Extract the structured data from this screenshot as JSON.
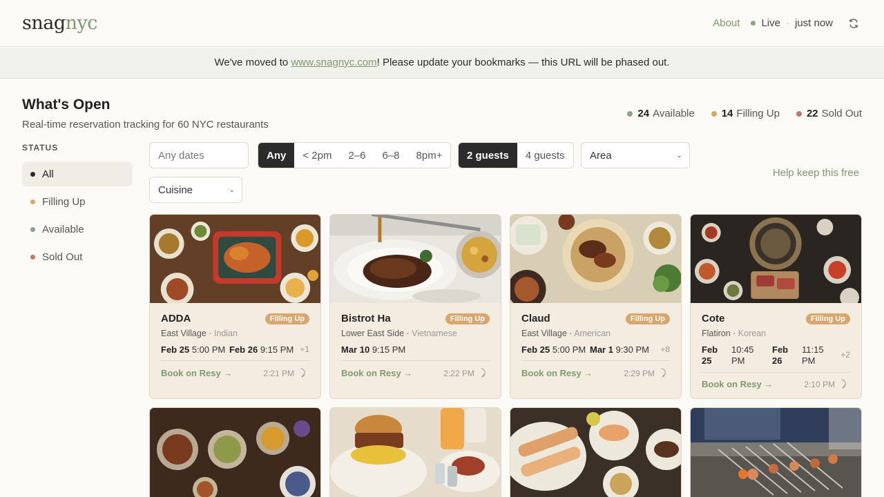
{
  "header": {
    "logo_main": "snag",
    "logo_accent": "nyc",
    "about": "About",
    "live": "Live",
    "separator": "·",
    "updated": "just now"
  },
  "banner": {
    "before": "We've moved to ",
    "link": "www.snagnyc.com",
    "after": "! Please update your bookmarks — this URL will be phased out."
  },
  "page": {
    "title": "What's Open",
    "subtitle": "Real-time reservation tracking for 60 NYC restaurants"
  },
  "summary": [
    {
      "count": "24",
      "label": "Available",
      "color": "#8ca384"
    },
    {
      "count": "14",
      "label": "Filling Up",
      "color": "#d9a66e"
    },
    {
      "count": "22",
      "label": "Sold Out",
      "color": "#c8746e"
    }
  ],
  "sidebar": {
    "label": "STATUS",
    "items": [
      {
        "label": "All",
        "color": "#2b2b2b"
      },
      {
        "label": "Filling Up",
        "color": "#d9a66e"
      },
      {
        "label": "Available",
        "color": "#8ca384"
      },
      {
        "label": "Sold Out",
        "color": "#c8746e"
      }
    ]
  },
  "filters": {
    "dates_placeholder": "Any dates",
    "times": [
      "Any",
      "< 2pm",
      "2–6",
      "6–8",
      "8pm+"
    ],
    "guests": [
      "2 guests",
      "4 guests"
    ],
    "area": "Area",
    "cuisine": "Cuisine",
    "help": "Help keep this free"
  },
  "cards": [
    {
      "name": "ADDA",
      "badge": "Filling Up",
      "area": "East Village",
      "cuisine": "Indian",
      "slots": [
        {
          "date": "Feb 25",
          "time": "5:00 PM"
        },
        {
          "date": "Feb 26",
          "time": "9:15 PM"
        }
      ],
      "more": "+1",
      "book": "Book on Resy →",
      "updated": "2:21 PM"
    },
    {
      "name": "Bistrot Ha",
      "badge": "Filling Up",
      "area": "Lower East Side",
      "cuisine": "Vietnamese",
      "slots": [
        {
          "date": "Mar 10",
          "time": "9:15 PM"
        }
      ],
      "more": "",
      "book": "Book on Resy →",
      "updated": "2:22 PM"
    },
    {
      "name": "Claud",
      "badge": "Filling Up",
      "area": "East Village",
      "cuisine": "American",
      "slots": [
        {
          "date": "Feb 25",
          "time": "5:00 PM"
        },
        {
          "date": "Mar 1",
          "time": "9:30 PM"
        }
      ],
      "more": "+8",
      "book": "Book on Resy →",
      "updated": "2:29 PM"
    },
    {
      "name": "Cote",
      "badge": "Filling Up",
      "area": "Flatiron",
      "cuisine": "Korean",
      "slots": [
        {
          "date": "Feb 25",
          "time": "10:45 PM"
        },
        {
          "date": "Feb 26",
          "time": "11:15 PM"
        }
      ],
      "more": "+2",
      "book": "Book on Resy →",
      "updated": "2:10 PM"
    }
  ],
  "colors": {
    "accent": "#7d9a6f",
    "badge": "#d9a66e",
    "card_bg": "#f4ece1"
  }
}
